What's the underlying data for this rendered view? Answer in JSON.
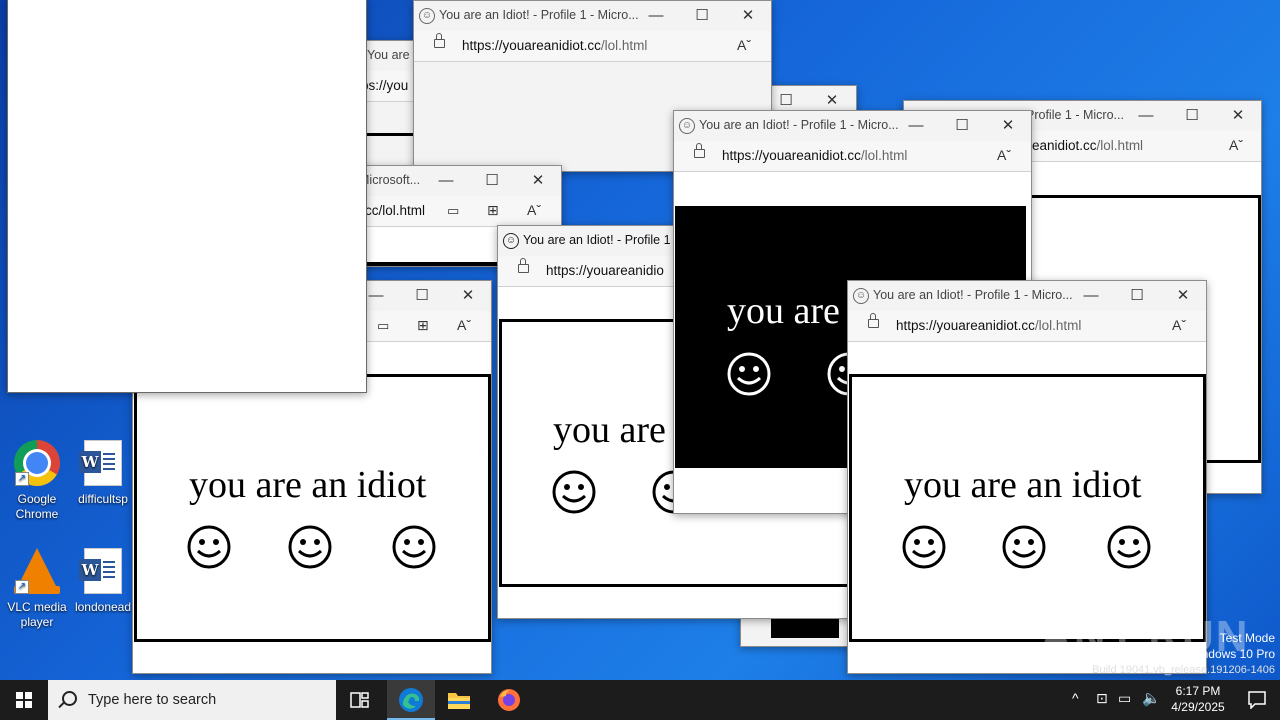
{
  "desktop": {
    "icons": [
      {
        "label": "Google Chrome",
        "icon": "chrome-icon"
      },
      {
        "label": "difficultsp",
        "icon": "word-doc-icon"
      },
      {
        "label": "VLC media player",
        "icon": "vlc-icon"
      },
      {
        "label": "londonead",
        "icon": "word-doc-icon"
      }
    ],
    "watermark": "ANY.RUN",
    "test_mode": {
      "line1": "Test Mode",
      "line2": "ndows 10 Pro",
      "line3": "Build 19041.vb_release.191206-1406"
    }
  },
  "browser_windows": {
    "title_full": "You are an Idiot! - Profile 1 - Micro...",
    "title_short": "You are an Idiot! - Profile 1 -",
    "title_fragment_micro": "Microsoft...",
    "title_fragment_profile": "Profile 1 - Micro...",
    "title_fragment_you": "You are an Idiot!",
    "url_host": "https://youareanidiot.cc",
    "url_path": "/lol.html",
    "url_cut_host": "https://youareanidio",
    "url_fragment_path": "cc/lol.html",
    "url_fragment_tail": "eanidiot.cc",
    "url_fragment_start": "ps://you",
    "message": "you are an idiot",
    "message_partial": "you are",
    "controls": {
      "minimize": "—",
      "maximize": "☐",
      "close": "✕"
    }
  },
  "taskbar": {
    "search_placeholder": "Type here to search",
    "pinned": [
      "task-view",
      "edge",
      "file-explorer",
      "firefox"
    ],
    "active": "edge",
    "clock_time": "6:17 PM",
    "clock_date": "4/29/2025"
  },
  "colors": {
    "desktop_bg": "#1565d8",
    "taskbar_bg": "#1c1c1c",
    "edge_accent": "#0f7bd6",
    "firefox_accent": "#ff7139"
  }
}
